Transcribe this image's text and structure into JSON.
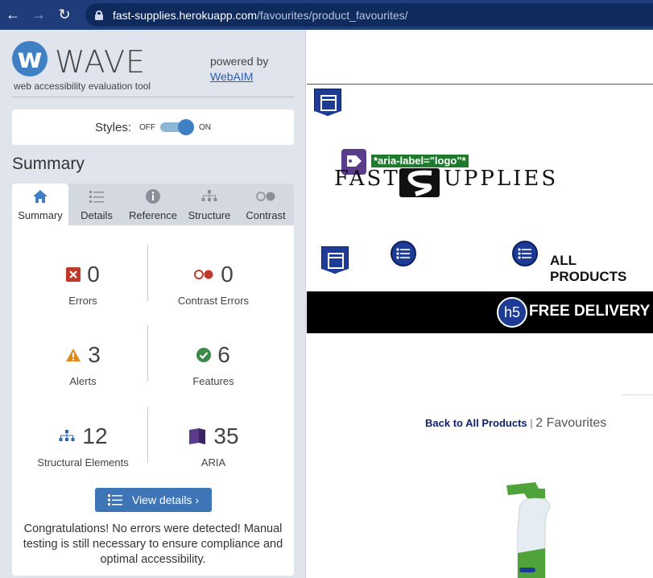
{
  "browser": {
    "url_host": "fast-supplies.herokuapp.com",
    "url_path": "/favourites/product_favourites/"
  },
  "wave": {
    "title": "WAVE",
    "subtitle": "web accessibility evaluation tool",
    "powered_by": "powered by",
    "webaim_link": "WebAIM",
    "styles_label": "Styles:",
    "styles_off": "OFF",
    "styles_on": "ON",
    "summary_heading": "Summary",
    "tabs": [
      {
        "label": "Summary",
        "icon": "home-icon",
        "active": true
      },
      {
        "label": "Details",
        "icon": "list-icon",
        "active": false
      },
      {
        "label": "Reference",
        "icon": "info-icon",
        "active": false
      },
      {
        "label": "Structure",
        "icon": "structure-icon",
        "active": false
      },
      {
        "label": "Contrast",
        "icon": "contrast-icon",
        "active": false
      }
    ],
    "stats": {
      "errors": {
        "count": "0",
        "label": "Errors"
      },
      "contrast_errors": {
        "count": "0",
        "label": "Contrast Errors"
      },
      "alerts": {
        "count": "3",
        "label": "Alerts"
      },
      "features": {
        "count": "6",
        "label": "Features"
      },
      "structural": {
        "count": "12",
        "label": "Structural Elements"
      },
      "aria": {
        "count": "35",
        "label": "ARIA"
      }
    },
    "view_details": "View details ›",
    "congrats": "Congratulations! No errors were detected! Manual testing is still necessary to ensure compliance and optimal accessibility."
  },
  "site": {
    "aria_label_tag": "*aria-label=\"logo\"*",
    "logo_left": "FAST",
    "logo_right": "UPPLIES",
    "nav_all_products": "ALL PRODUCTS",
    "h5_badge": "h5",
    "delivery_text": "FREE DELIVERY O",
    "back_link": "Back to All Products",
    "separator": " | ",
    "favourites_count": "2 Favourites"
  },
  "colors": {
    "wave_blue": "#3f7fc4",
    "browser_bar": "#1f3d7a",
    "error_red": "#c0392b",
    "alert_orange": "#e08a1e",
    "feature_green": "#3c8a4a",
    "aria_purple": "#5a3c8a",
    "badge_blue": "#1e3c96"
  }
}
